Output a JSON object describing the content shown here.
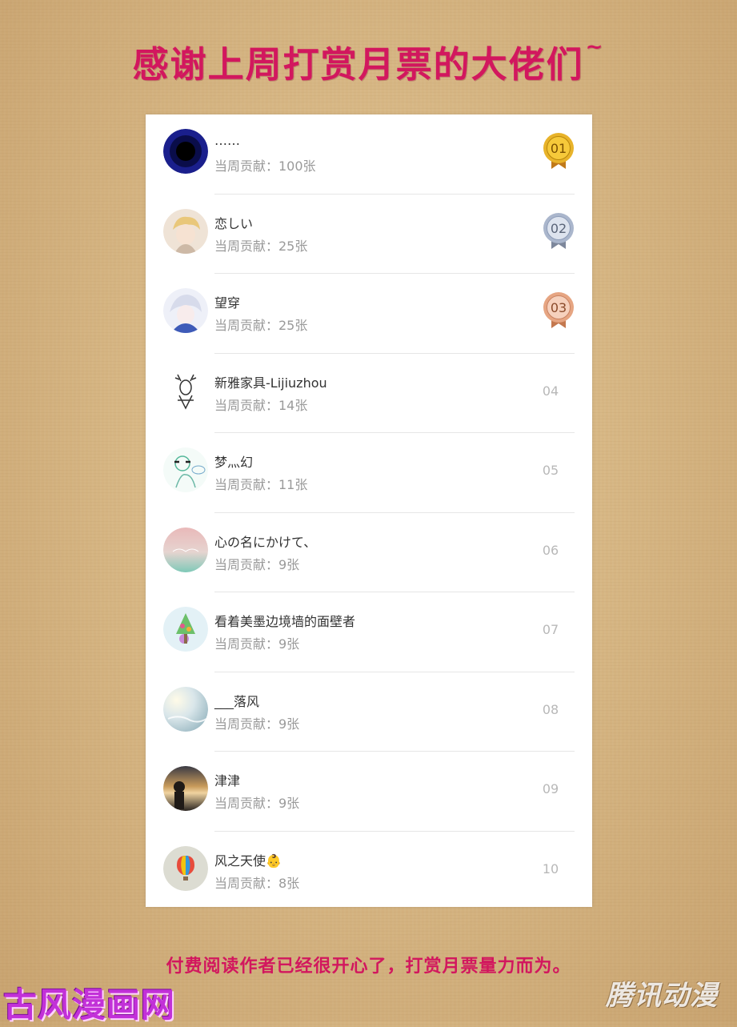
{
  "header": {
    "title": "感谢上周打赏月票的大佬们",
    "title_suffix": "~"
  },
  "list": {
    "contribution_prefix": "当周贡献：",
    "items": [
      {
        "rank": "01",
        "name": "……",
        "contribution": "当周贡献：100张",
        "avatar": "dark-blue-circle-avatar",
        "badge": "gold-medal"
      },
      {
        "rank": "02",
        "name": "恋しい",
        "contribution": "当周贡献：25张",
        "avatar": "anime-boy-blonde-avatar",
        "badge": "silver-medal"
      },
      {
        "rank": "03",
        "name": "望穿",
        "contribution": "当周贡献：25张",
        "avatar": "anime-white-hair-avatar",
        "badge": "bronze-medal"
      },
      {
        "rank": "04",
        "name": "新雅家具-Lijiuzhou",
        "contribution": "当周贡献：14张",
        "avatar": "deer-sketch-avatar",
        "badge": ""
      },
      {
        "rank": "05",
        "name": "梦灬幻",
        "contribution": "当周贡献：11张",
        "avatar": "cartoon-sketch-avatar",
        "badge": ""
      },
      {
        "rank": "06",
        "name": "心の名にかけて、",
        "contribution": "当周贡献：9张",
        "avatar": "pastel-landscape-avatar",
        "badge": ""
      },
      {
        "rank": "07",
        "name": "看着美墨边境墙的面壁者",
        "contribution": "当周贡献：9张",
        "avatar": "colorful-tree-avatar",
        "badge": ""
      },
      {
        "rank": "08",
        "name": "___落风",
        "contribution": "当周贡献：9张",
        "avatar": "hazy-sky-avatar",
        "badge": ""
      },
      {
        "rank": "09",
        "name": "津津",
        "contribution": "当周贡献：9张",
        "avatar": "sunset-photo-avatar",
        "badge": ""
      },
      {
        "rank": "10",
        "name": "风之天使👶",
        "contribution": "当周贡献：8张",
        "avatar": "hot-air-balloon-avatar",
        "badge": ""
      }
    ]
  },
  "footer": {
    "text": "付费阅读作者已经很开心了，打赏月票量力而为。"
  },
  "watermarks": {
    "left": "古风漫画网",
    "right": "腾讯动漫"
  },
  "colors": {
    "accent": "#d2175e",
    "gold": "#e8b32a",
    "silver": "#8d9cb8",
    "bronze": "#d99570"
  }
}
